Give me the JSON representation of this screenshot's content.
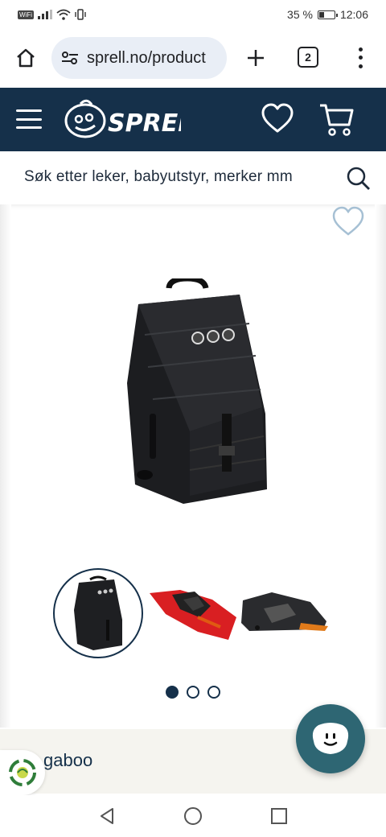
{
  "status": {
    "carrier_badge": "WiFi",
    "battery": "35 %",
    "time": "12:06"
  },
  "browser": {
    "url": "sprell.no/product",
    "tab_count": "2"
  },
  "site": {
    "logo_text": "SPRELL"
  },
  "search": {
    "placeholder": "Søk etter leker, babyutstyr, merker mm"
  },
  "product": {
    "thumbnails": [
      "bag-upright",
      "bag-open-red",
      "bag-side-stroller"
    ],
    "carousel": {
      "count": 3,
      "active_index": 0
    },
    "brand_partial": "gaboo"
  },
  "colors": {
    "header": "#15304a",
    "chat": "#2e6673",
    "url_pill": "#e9eef6"
  }
}
